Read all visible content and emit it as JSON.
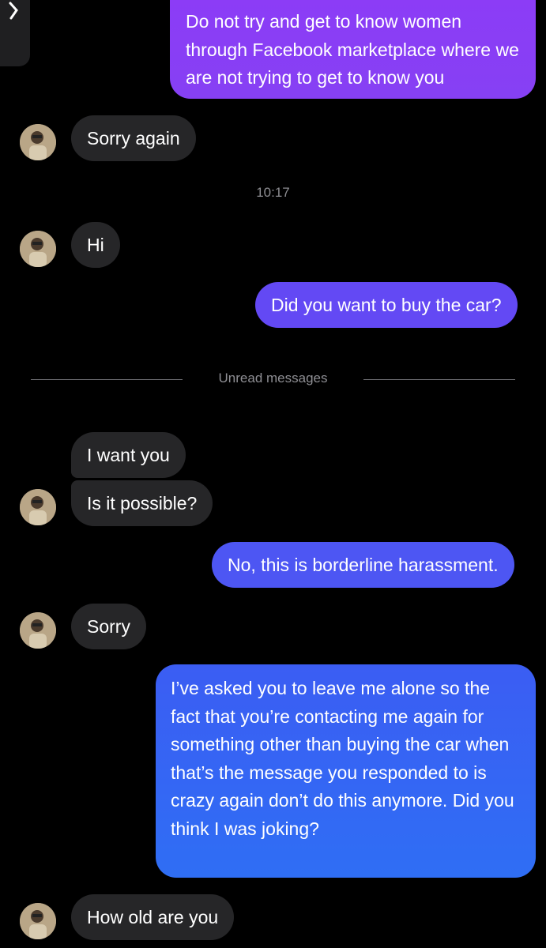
{
  "conversation": {
    "timestamp": "10:17",
    "unread_divider": "Unread messages",
    "messages": [
      {
        "text": "Do not try and get to know women through Facebook marketplace where we are not trying to get to know you"
      },
      {
        "text": "Sorry again"
      },
      {
        "text": "Hi"
      },
      {
        "text": "Did you want to buy the car?"
      },
      {
        "text": "I want you"
      },
      {
        "text": "Is it possible?"
      },
      {
        "text": "No, this is borderline harassment."
      },
      {
        "text": "Sorry"
      },
      {
        "text": "I’ve asked you to leave me alone so the fact that you’re contacting me again for something other than buying the car when that’s the message you responded to is crazy again don’t do this anymore. Did you think I was joking?"
      },
      {
        "text": "How old are you"
      }
    ]
  },
  "colors": {
    "background": "#000000",
    "incoming_bubble": "#262628",
    "outgoing_purple": "#8a3cf5",
    "outgoing_violet": "#5a52f3",
    "outgoing_blue": "#2f6cf4",
    "meta_text": "#8e8e93"
  },
  "icons": {
    "back": "chevron-right-icon",
    "avatar": "contact-avatar"
  }
}
